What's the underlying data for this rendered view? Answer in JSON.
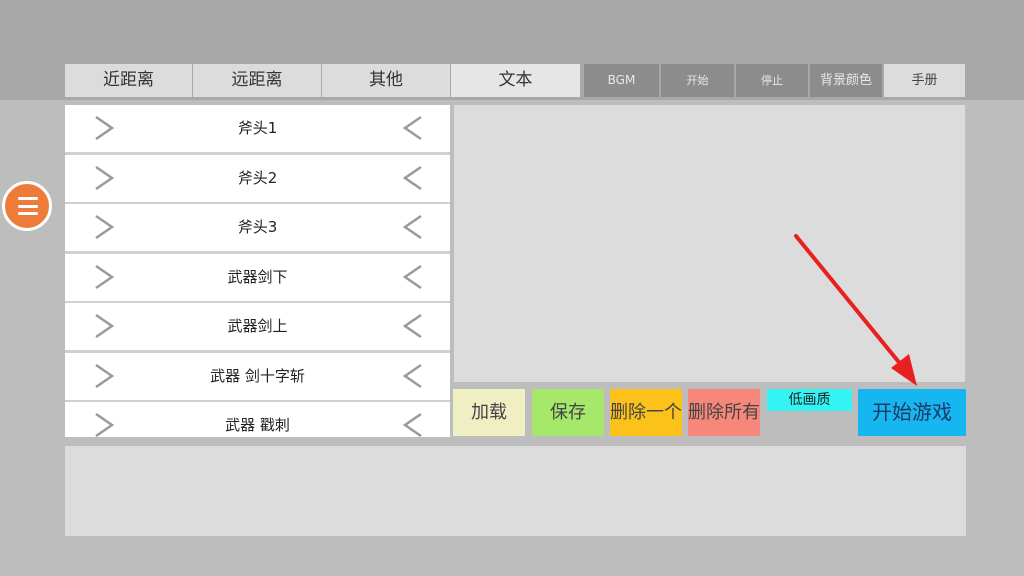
{
  "tabs": [
    "近距离",
    "远距离",
    "其他",
    "文本"
  ],
  "toolbar": {
    "bgm": "BGM",
    "start": "开始",
    "stop": "停止",
    "bg_color": "背景颜色",
    "manual": "手册"
  },
  "list": {
    "items": [
      "斧头1",
      "斧头2",
      "斧头3",
      "武器剑下",
      "武器剑上",
      "武器 剑十字斩",
      "武器 戳刺"
    ]
  },
  "actions": {
    "load": "加载",
    "save": "保存",
    "delete_one": "删除一个",
    "delete_all": "删除所有",
    "low_quality": "低画质",
    "start_game": "开始游戏"
  },
  "colors": {
    "load": "#f0efc4",
    "save": "#a6e86a",
    "delete_one": "#fcc21a",
    "delete_all": "#f7877a",
    "low_quality": "#33f3f3",
    "start_game": "#16b6f0",
    "menu": "#ef7b3b",
    "annotation_arrow": "#e8201f"
  },
  "icons": {
    "menu": "hamburger-icon",
    "row_left": "chevron-right-icon",
    "row_right": "chevron-left-icon"
  }
}
